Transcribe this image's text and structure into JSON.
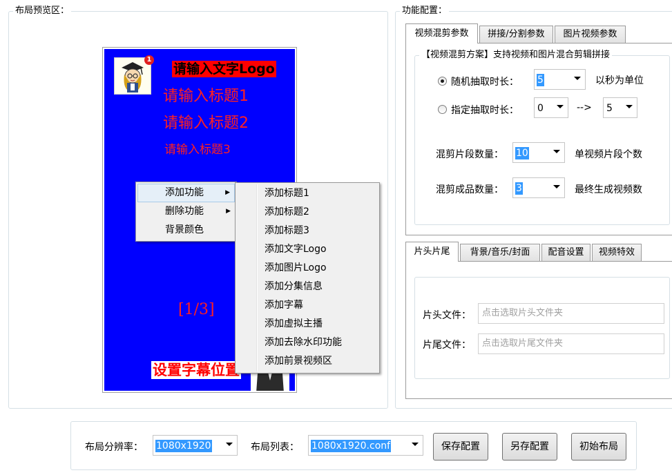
{
  "preview": {
    "group_title": "布局预览区：",
    "canvas": {
      "bg_color": "#0000ff",
      "text_logo": "请输入文字Logo",
      "title1": "请输入标题1",
      "title2": "请输入标题2",
      "title3": "请输入标题3",
      "page_indicator": "[1/3]",
      "subtitle": "设置字幕位置",
      "avatar_badge": "1"
    },
    "context_menu": {
      "items": [
        "添加功能",
        "删除功能",
        "背景颜色"
      ]
    },
    "submenu": {
      "items": [
        "添加标题1",
        "添加标题2",
        "添加标题3",
        "添加文字Logo",
        "添加图片Logo",
        "添加分集信息",
        "添加字幕",
        "添加虚拟主播",
        "添加去除水印功能",
        "添加前景视频区"
      ]
    }
  },
  "config": {
    "group_title": "功能配置：",
    "top_tabs": [
      "视频混剪参数",
      "拼接/分割参数",
      "图片视频参数"
    ],
    "scheme": {
      "title": "【视频混剪方案】支持视频和图片混合剪辑拼接",
      "random_label": "随机抽取时长：",
      "random_value": "5",
      "random_unit": "以秒为单位",
      "specified_label": "指定抽取时长：",
      "specified_from": "0",
      "specified_arrow": "-->",
      "specified_to": "5",
      "segments_label": "混剪片段数量：",
      "segments_value": "10",
      "segments_hint": "单视频片段个数",
      "outputs_label": "混剪成品数量：",
      "outputs_value": "3",
      "outputs_hint": "最终生成视频数"
    },
    "bottom_tabs": [
      "片头片尾",
      "背景/音乐/封面",
      "配音设置",
      "视频特效"
    ],
    "intro_outro": {
      "intro_label": "片头文件：",
      "intro_placeholder": "点击选取片头文件夹",
      "outro_label": "片尾文件：",
      "outro_placeholder": "点击选取片尾文件夹"
    }
  },
  "footer": {
    "resolution_label": "布局分辨率：",
    "resolution_value": "1080x1920",
    "layout_list_label": "布局列表：",
    "layout_list_value": "1080x1920.conf",
    "save_button": "保存配置",
    "save_as_button": "另存配置",
    "reset_button": "初始布局"
  }
}
